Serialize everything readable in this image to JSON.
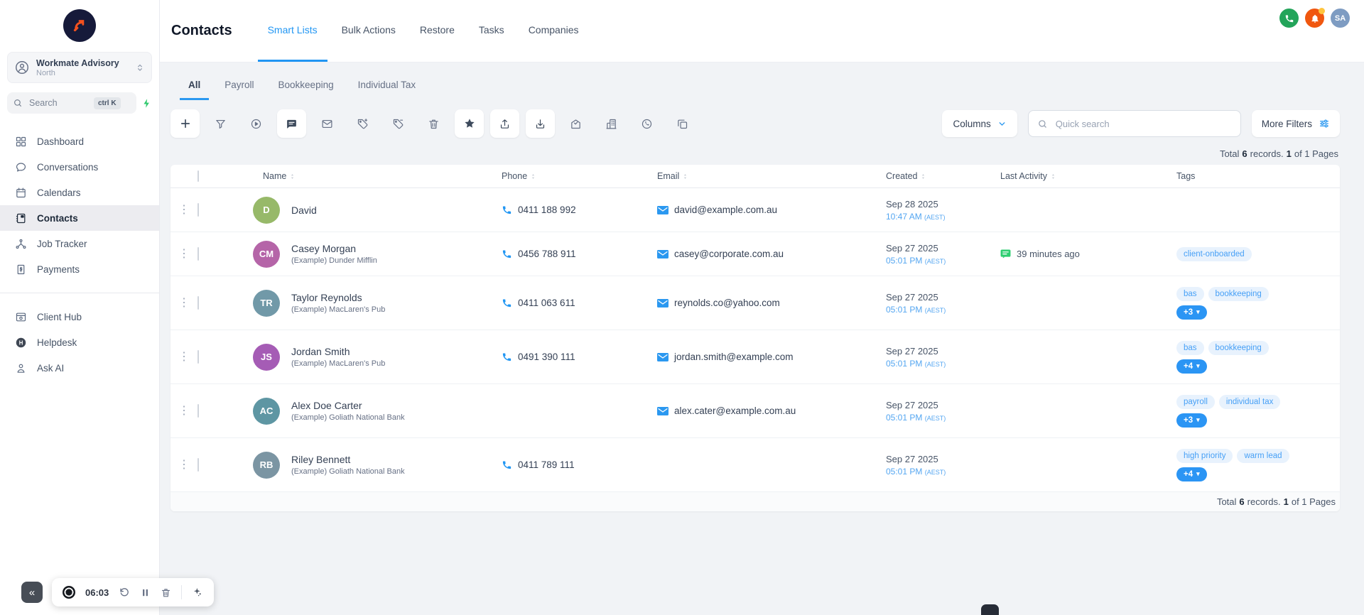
{
  "sidebar": {
    "workspace": {
      "name": "Workmate Advisory",
      "location": "North"
    },
    "search": {
      "placeholder": "Search",
      "shortcut": "ctrl K"
    },
    "items": [
      {
        "label": "Dashboard",
        "icon": "dashboard",
        "active": false
      },
      {
        "label": "Conversations",
        "icon": "conversations",
        "active": false
      },
      {
        "label": "Calendars",
        "icon": "calendars",
        "active": false
      },
      {
        "label": "Contacts",
        "icon": "contacts",
        "active": true
      },
      {
        "label": "Job Tracker",
        "icon": "job-tracker",
        "active": false
      },
      {
        "label": "Payments",
        "icon": "payments",
        "active": false
      },
      {
        "label": "Client Hub",
        "icon": "client-hub",
        "active": false,
        "section": 2
      },
      {
        "label": "Helpdesk",
        "icon": "helpdesk",
        "active": false,
        "section": 2
      },
      {
        "label": "Ask AI",
        "icon": "ask-ai",
        "active": false,
        "section": 2
      }
    ]
  },
  "topbar": {
    "title": "Contacts",
    "tabs": [
      {
        "label": "Smart Lists",
        "active": true
      },
      {
        "label": "Bulk Actions",
        "active": false
      },
      {
        "label": "Restore",
        "active": false
      },
      {
        "label": "Tasks",
        "active": false
      },
      {
        "label": "Companies",
        "active": false
      }
    ],
    "avatar_initials": "SA"
  },
  "smart_list_tabs": [
    {
      "label": "All",
      "active": true
    },
    {
      "label": "Payroll",
      "active": false
    },
    {
      "label": "Bookkeeping",
      "active": false
    },
    {
      "label": "Individual Tax",
      "active": false
    }
  ],
  "toolbar": {
    "icons": [
      {
        "name": "add",
        "highlighted": true
      },
      {
        "name": "filter",
        "highlighted": false
      },
      {
        "name": "automation",
        "highlighted": false
      },
      {
        "name": "message",
        "highlighted": true
      },
      {
        "name": "email",
        "highlighted": false
      },
      {
        "name": "add-tag",
        "highlighted": false
      },
      {
        "name": "remove-tag",
        "highlighted": false
      },
      {
        "name": "delete",
        "highlighted": false
      },
      {
        "name": "favorite",
        "highlighted": true
      },
      {
        "name": "export",
        "highlighted": true
      },
      {
        "name": "import",
        "highlighted": true
      },
      {
        "name": "review-request",
        "highlighted": false
      },
      {
        "name": "company",
        "highlighted": false
      },
      {
        "name": "whatsapp",
        "highlighted": false
      },
      {
        "name": "merge",
        "highlighted": false
      }
    ],
    "columns_label": "Columns",
    "quick_search_placeholder": "Quick search",
    "more_filters_label": "More Filters"
  },
  "summary": {
    "label_total": "Total",
    "count": "6",
    "label_records": "records.",
    "page": "1",
    "label_pages": "of 1 Pages"
  },
  "table": {
    "columns": [
      {
        "label": "Name",
        "sortable": true
      },
      {
        "label": "Phone",
        "sortable": true
      },
      {
        "label": "Email",
        "sortable": true
      },
      {
        "label": "Created",
        "sortable": true
      },
      {
        "label": "Last Activity",
        "sortable": true
      },
      {
        "label": "Tags",
        "sortable": false
      }
    ],
    "rows": [
      {
        "initial": "D",
        "avatar_color": "#97b969",
        "name": "David",
        "company": "",
        "phone": "0411 188 992",
        "email": "david@example.com.au",
        "created_date": "Sep 28 2025",
        "created_time": "10:47 AM",
        "created_tz": "(AEST)",
        "last_activity": "",
        "tags": [],
        "more_tags": ""
      },
      {
        "initial": "CM",
        "avatar_color": "#b565a8",
        "name": "Casey Morgan",
        "company": "(Example) Dunder Mifflin",
        "phone": "0456 788 911",
        "email": "casey@corporate.com.au",
        "created_date": "Sep 27 2025",
        "created_time": "05:01 PM",
        "created_tz": "(AEST)",
        "last_activity": "39 minutes ago",
        "tags": [
          "client-onboarded"
        ],
        "more_tags": ""
      },
      {
        "initial": "TR",
        "avatar_color": "#7199a8",
        "name": "Taylor Reynolds",
        "company": "(Example) MacLaren's Pub",
        "phone": "0411 063 611",
        "email": "reynolds.co@yahoo.com",
        "created_date": "Sep 27 2025",
        "created_time": "05:01 PM",
        "created_tz": "(AEST)",
        "last_activity": "",
        "tags": [
          "bas",
          "bookkeeping"
        ],
        "more_tags": "+3"
      },
      {
        "initial": "JS",
        "avatar_color": "#a55cb5",
        "name": "Jordan Smith",
        "company": "(Example) MacLaren's Pub",
        "phone": "0491 390 111",
        "email": "jordan.smith@example.com",
        "created_date": "Sep 27 2025",
        "created_time": "05:01 PM",
        "created_tz": "(AEST)",
        "last_activity": "",
        "tags": [
          "bas",
          "bookkeeping"
        ],
        "more_tags": "+4"
      },
      {
        "initial": "AC",
        "avatar_color": "#5e96a3",
        "name": "Alex Doe Carter",
        "company": "(Example) Goliath National Bank",
        "phone": "",
        "email": "alex.cater@example.com.au",
        "created_date": "Sep 27 2025",
        "created_time": "05:01 PM",
        "created_tz": "(AEST)",
        "last_activity": "",
        "tags": [
          "payroll",
          "individual tax"
        ],
        "more_tags": "+3"
      },
      {
        "initial": "RB",
        "avatar_color": "#7b95a3",
        "name": "Riley Bennett",
        "company": "(Example) Goliath National Bank",
        "phone": "0411 789 111",
        "email": "",
        "created_date": "Sep 27 2025",
        "created_time": "05:01 PM",
        "created_tz": "(AEST)",
        "last_activity": "",
        "tags": [
          "high priority",
          "warm lead"
        ],
        "more_tags": "+4"
      }
    ]
  },
  "recorder": {
    "time": "06:03"
  },
  "colors": {
    "accent": "#2196f3",
    "tag_text": "#47a0f6",
    "tag_bg": "#e8f2fd",
    "phone_green": "#23a45a",
    "bell_orange": "#f0570f",
    "activity_green": "#2ece71",
    "logo_arrow": "#f4511e"
  }
}
